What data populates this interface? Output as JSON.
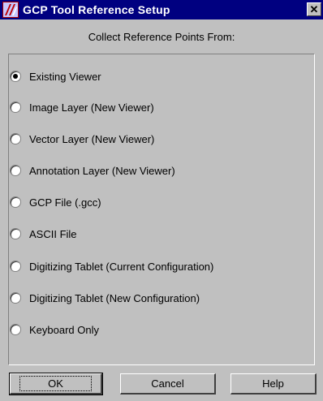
{
  "window": {
    "title": "GCP Tool Reference Setup",
    "close_label": "✕"
  },
  "subtitle": "Collect Reference Points From:",
  "options": [
    {
      "label": "Existing Viewer",
      "checked": true
    },
    {
      "label": "Image Layer (New Viewer)",
      "checked": false
    },
    {
      "label": "Vector Layer (New Viewer)",
      "checked": false
    },
    {
      "label": "Annotation Layer (New Viewer)",
      "checked": false
    },
    {
      "label": "GCP File (.gcc)",
      "checked": false
    },
    {
      "label": "ASCII File",
      "checked": false
    },
    {
      "label": "Digitizing Tablet (Current Configuration)",
      "checked": false
    },
    {
      "label": "Digitizing Tablet (New Configuration)",
      "checked": false
    },
    {
      "label": "Keyboard Only",
      "checked": false
    }
  ],
  "buttons": {
    "ok": "OK",
    "cancel": "Cancel",
    "help": "Help"
  }
}
